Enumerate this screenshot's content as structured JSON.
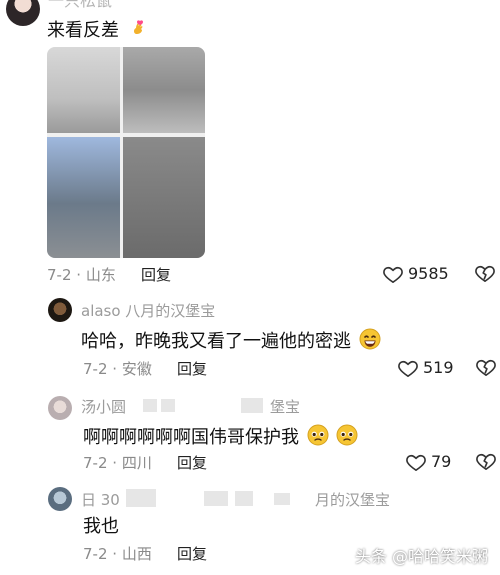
{
  "top_comment": {
    "username": "一只松鼠",
    "text": "来看反差",
    "date": "7-2",
    "location": "山东",
    "reply_label": "回复",
    "likes": "9585"
  },
  "replies": [
    {
      "username": "alaso 八月的汉堡宝",
      "text": "哈哈，昨晚我又看了一遍他的密逃",
      "date": "7-2",
      "location": "安徽",
      "reply_label": "回复",
      "likes": "519"
    },
    {
      "username_left": "汤小圆",
      "username_right": "堡宝",
      "text": "啊啊啊啊啊啊国伟哥保护我",
      "date": "7-2",
      "location": "四川",
      "reply_label": "回复",
      "likes": "79"
    },
    {
      "username_left": "日 30",
      "username_right": "月的汉堡宝",
      "text": "我也",
      "date": "7-2",
      "location": "山西",
      "reply_label": "回复"
    }
  ],
  "separator": "·",
  "watermark": "头条 @哈哈笑米粥"
}
